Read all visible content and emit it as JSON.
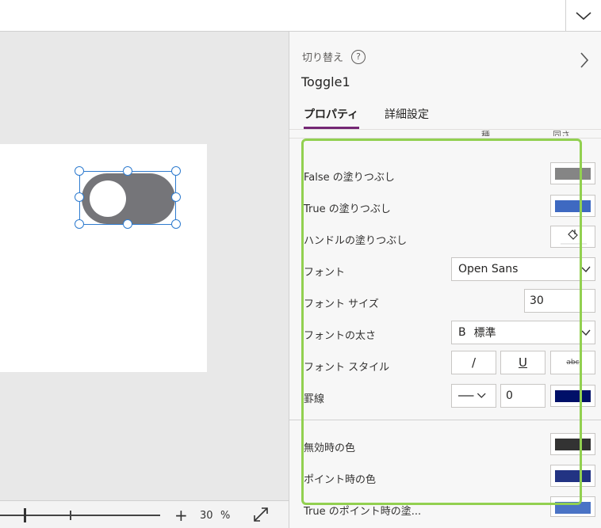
{
  "panel": {
    "control_type": "切り替え",
    "help_glyph": "?",
    "control_name": "Toggle1",
    "tabs": [
      {
        "label": "プロパティ",
        "active": true
      },
      {
        "label": "詳細設定",
        "active": false
      }
    ],
    "clipped_texts": [
      "種",
      "同さ"
    ]
  },
  "properties": {
    "false_fill": {
      "label": "False の塗りつぶし",
      "color": "#858585"
    },
    "true_fill": {
      "label": "True の塗りつぶし",
      "color": "#3e69c1"
    },
    "handle_fill": {
      "label": "ハンドルの塗りつぶし",
      "color": "#ffffff"
    },
    "font": {
      "label": "フォント",
      "value": "Open Sans"
    },
    "font_size": {
      "label": "フォント サイズ",
      "value": "30"
    },
    "font_weight": {
      "label": "フォントの太さ",
      "glyph": "B",
      "value": "標準"
    },
    "font_style": {
      "label": "フォント スタイル",
      "italic": "/",
      "underline": "U",
      "strike": "abc"
    },
    "border": {
      "label": "罫線",
      "thickness": "0",
      "color": "#001068"
    },
    "disabled_color": {
      "label": "無効時の色",
      "color": "#333333"
    },
    "hover_color": {
      "label": "ポイント時の色",
      "color": "#223383"
    },
    "true_hover_fill": {
      "label": "True のポイント時の塗...",
      "color": "#4a73c5"
    }
  },
  "zoom": {
    "plus": "+",
    "value": "30",
    "unit": "%"
  },
  "canvas": {
    "toggle_track_color": "#757579"
  },
  "colors": {
    "accent": "#742774",
    "selection": "#2e7bcf",
    "highlight": "#92d050"
  }
}
